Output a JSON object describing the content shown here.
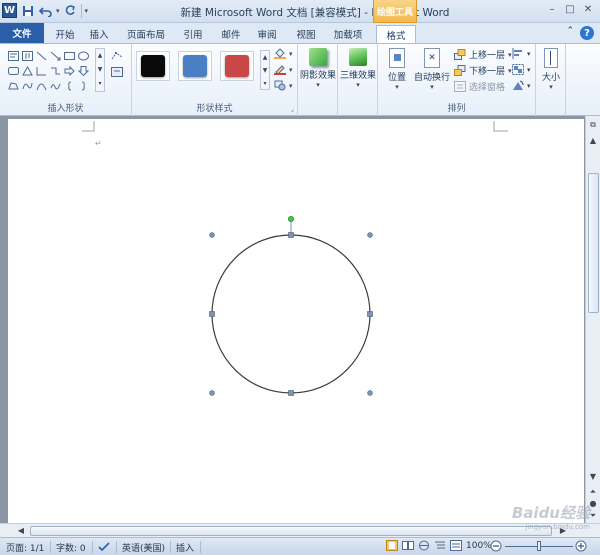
{
  "window": {
    "title": "新建 Microsoft Word 文档 [兼容模式] - Microsoft Word",
    "context_tab": "绘图工具",
    "controls": [
      "–",
      "□",
      "✕"
    ]
  },
  "tabs": {
    "file": "文件",
    "items": [
      "开始",
      "插入",
      "页面布局",
      "引用",
      "邮件",
      "审阅",
      "视图",
      "加载项",
      "格式"
    ],
    "active": "格式"
  },
  "ribbon": {
    "insert_shapes": {
      "label": "插入形状"
    },
    "shape_styles": {
      "label": "形状样式",
      "swatches": [
        "#0a0a0a",
        "#4a80c3",
        "#c84848"
      ]
    },
    "shadow_effects": {
      "label": "阴影效果"
    },
    "three_d_effects": {
      "label": "三维效果"
    },
    "arrange": {
      "label": "排列",
      "position": "位置",
      "wrap_text": "自动换行",
      "bring_forward": "上移一层",
      "send_backward": "下移一层",
      "selection_pane": "选择窗格"
    },
    "size": {
      "label": "大小"
    }
  },
  "statusbar": {
    "page": "页面: 1/1",
    "words": "字数: 0",
    "language": "英语(美国)",
    "mode": "插入",
    "zoom": "100%"
  },
  "watermark": {
    "text": "Baidu经验",
    "sub": "jingyan.baidu.com"
  },
  "colors": {
    "accent": "#2a5ea8",
    "context": "#f4b84b",
    "handle_fill": "#7d94b5",
    "rotate_handle": "#3ec84a"
  }
}
